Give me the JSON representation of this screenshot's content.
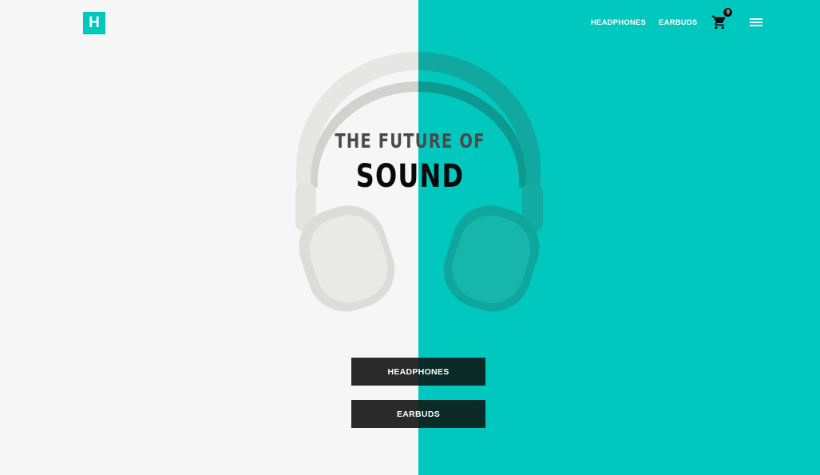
{
  "brand": {
    "logo_letter": "H"
  },
  "nav": {
    "links": [
      "HEADPHONES",
      "EARBUDS"
    ],
    "cart_count": "0"
  },
  "hero": {
    "title_small": "THE FUTURE OF",
    "title_big": "SOUND"
  },
  "buttons": {
    "headphones": "HEADPHONES",
    "earbuds": "EARBUDS"
  },
  "colors": {
    "accent": "#00c8bf",
    "left_bg": "#f6f6f6",
    "button_bg": "#2a2a2a"
  }
}
